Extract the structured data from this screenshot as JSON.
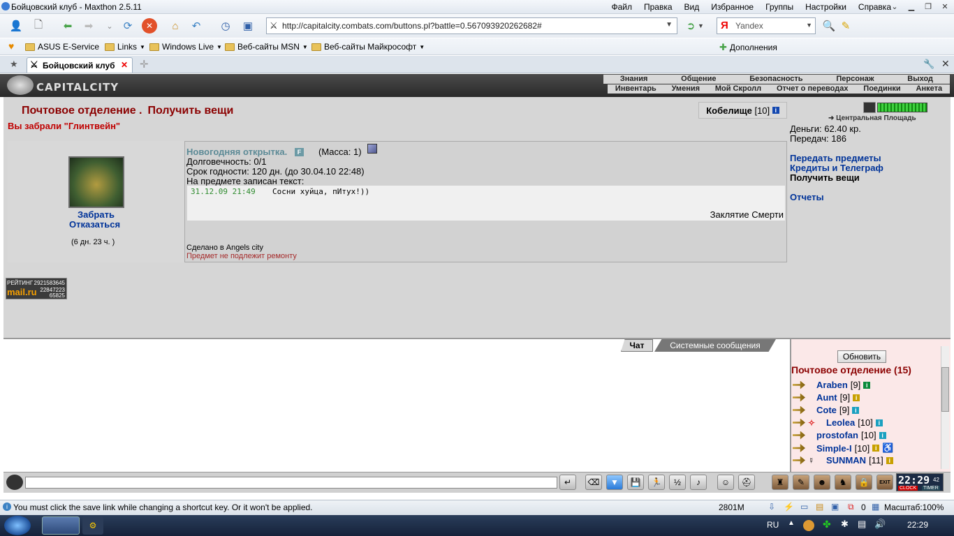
{
  "window": {
    "title": "Бойцовский клуб - Maxthon 2.5.11"
  },
  "menu": [
    "Файл",
    "Правка",
    "Вид",
    "Избранное",
    "Группы",
    "Настройки",
    "Справка"
  ],
  "address": {
    "url": "http://capitalcity.combats.com/buttons.pl?battle=0.567093920262682#"
  },
  "search": {
    "engine": "Yandex"
  },
  "favorites": [
    {
      "label": "ASUS E-Service"
    },
    {
      "label": "Links"
    },
    {
      "label": "Windows Live"
    },
    {
      "label": "Веб-сайты MSN"
    },
    {
      "label": "Веб-сайты Майкрософт"
    }
  ],
  "addons": "Дополнения",
  "tab": {
    "title": "Бойцовский клуб"
  },
  "site": {
    "logo": "CAPITALCITY",
    "menu_top": [
      "Знания",
      "Общение",
      "Безопасность",
      "Персонаж",
      "Выход"
    ],
    "menu_bottom": [
      "Инвентарь",
      "Умения",
      "Мой Скролл",
      "Отчет о переводах",
      "Поединки",
      "Анкета"
    ]
  },
  "post": {
    "title": "Почтовое отделение .",
    "subtitle": "Получить вещи",
    "picked": "Вы забрали \"Глинтвейн\"",
    "character": "Кобелище",
    "character_level": "[10]"
  },
  "item": {
    "name": "Новогодняя открытка.",
    "mass": "(Масса: 1)",
    "durability": "Долговечность: 0/1",
    "expiry": "Срок годности: 120 дн. (до 30.04.10 22:48)",
    "inscription_label": "На предмете записан текст:",
    "inscription_date": "31.12.09 21:49",
    "inscription_text": "Сосни хуйца, пИтух!))",
    "spell": "Заклятие Смерти",
    "made": "Сделано в Angels city",
    "repair": "Предмет не подлежит ремонту",
    "take": "Забрать",
    "refuse": "Отказаться",
    "time_left": "(6 дн. 23 ч. )"
  },
  "counter": {
    "label": "РЕЙТИНГ",
    "n1": "2921583645",
    "n2": "22847223",
    "n3": "65825",
    "brand": "mail.ru"
  },
  "right": {
    "location": "Центральная Площадь",
    "money": "Деньги: 62.40 кр.",
    "transfers": "Передач: 186",
    "links": [
      "Передать предметы",
      "Кредиты и Телеграф",
      "Получить вещи",
      "Отчеты"
    ]
  },
  "chat": {
    "tab_chat": "Чат",
    "tab_system": "Системные сообщения"
  },
  "users": {
    "refresh": "Обновить",
    "title": "Почтовое отделение (15)",
    "list": [
      {
        "name": "Araben",
        "level": "[9]"
      },
      {
        "name": "Aunt",
        "level": "[9]"
      },
      {
        "name": "Cote",
        "level": "[9]"
      },
      {
        "name": "Leolea",
        "level": "[10]"
      },
      {
        "name": "prostofan",
        "level": "[10]"
      },
      {
        "name": "Simple-I",
        "level": "[10]"
      },
      {
        "name": "SUNMAN",
        "level": "[11]"
      }
    ]
  },
  "clock": {
    "time": "22:29",
    "sec": "42",
    "clock_label": "CLOCK",
    "timer_label": "TIMER",
    "exit": "EXIT"
  },
  "status": {
    "message": "You must click the save link while changing a shortcut key. Or it won't be applied.",
    "memory": "2801M",
    "counter": "0",
    "zoom": "Масштаб:100%"
  },
  "taskbar": {
    "lang": "RU",
    "time": "22:29"
  }
}
